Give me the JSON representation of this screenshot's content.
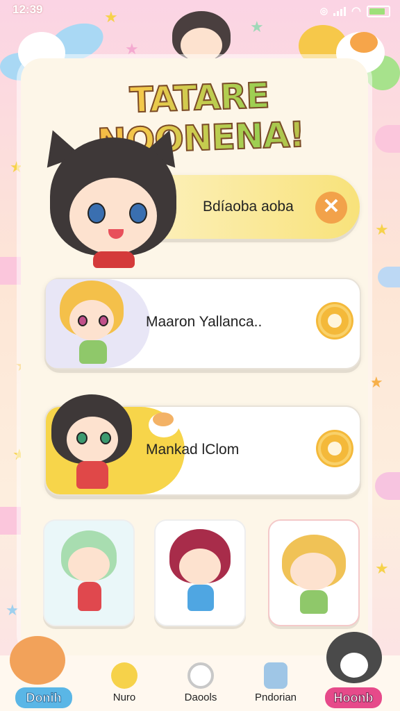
{
  "status": {
    "time": "12:39"
  },
  "app": {
    "title": "TATARE NOONENA!"
  },
  "cards": [
    {
      "label": "Bdíaoba aoba"
    },
    {
      "label": "Maaron Yallanca.."
    },
    {
      "label": "Mankad lClom"
    }
  ],
  "nav": {
    "items": [
      {
        "label": "Donih"
      },
      {
        "label": "Nuro"
      },
      {
        "label": "Daools"
      },
      {
        "label": "Pndorian"
      },
      {
        "label": "Hoonb"
      }
    ]
  },
  "colors": {
    "accent": "#f6c84a",
    "close": "#f2a24a",
    "nav_pill": "#5ab6e6"
  }
}
